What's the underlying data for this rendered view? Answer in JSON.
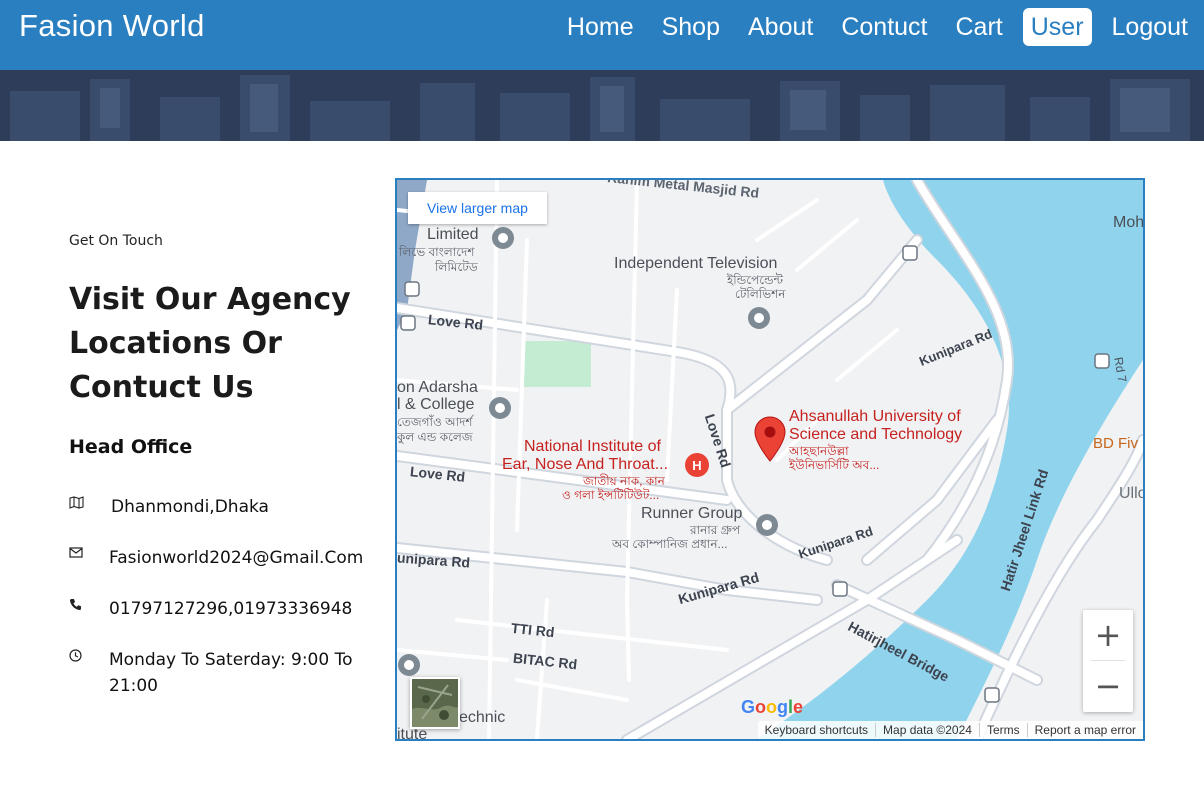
{
  "navbar": {
    "brand": "Fasion World",
    "links": [
      "Home",
      "Shop",
      "About",
      "Contuct",
      "Cart",
      "User",
      "Logout"
    ],
    "active_index": 5,
    "background": "#2a7fc0"
  },
  "contact": {
    "subtitle": "Get On Touch",
    "headline": "Visit Our Agency Locations Or Contuct Us",
    "office_heading": "Head Office",
    "address": "Dhanmondi,Dhaka",
    "email": "Fasionworld2024@Gmail.Com",
    "phone": "01797127296,01973336948",
    "hours": "Monday To Saterday: 9:00 To 21:00",
    "icons": [
      "map-icon",
      "envelope-icon",
      "phone-icon",
      "clock-icon"
    ]
  },
  "map": {
    "view_larger": "View larger map",
    "zoom_in": "+",
    "zoom_out": "−",
    "google": "Google",
    "attribution": [
      "Keyboard shortcuts",
      "Map data ©2024",
      "Terms",
      "Report a map error"
    ],
    "labels": {
      "masjid": "Rahim Metal Masjid Rd",
      "limited": "Limited",
      "limited_bn1": "লিভে বাংলাদেশ",
      "limited_bn2": "লিমিটেড",
      "independent": "Independent Television",
      "independent_bn1": "ইন্ডিপেন্ডেন্ট",
      "independent_bn2": "টেলিভিশন",
      "mohakhali": "Moh",
      "love_rd_1": "Love Rd",
      "love_rd_2": "Love Rd",
      "love_rd_3": "Love Rd",
      "kunipara_1": "Kunipara Rd",
      "kunipara_2": "Kunipara Rd",
      "kunipara_3": "Kunipara Rd",
      "kunipara_4": "unipara Rd",
      "rd7": "Rd 7",
      "adarsha_1": "on Adarsha",
      "adarsha_2": "l & College",
      "adarsha_bn1": "তেজগাঁও আদর্শ",
      "adarsha_bn2": "কুল এন্ড কলেজ",
      "ahsanullah_1": "Ahsanullah University of",
      "ahsanullah_2": "Science and Technology",
      "ahsanullah_bn1": "আহছানউল্লা",
      "ahsanullah_bn2": "ইউনিভার্সিটি অব...",
      "bd_five": "BD Fiv",
      "ullo": "Ullo",
      "nin_1": "National Institute of",
      "nin_2": "Ear, Nose And Throat...",
      "nin_bn1": "জাতীয় নাক, কান",
      "nin_bn2": "ও গলা ইন্সটিটিউট...",
      "runner": "Runner Group",
      "runner_bn1": "রানার গ্রুপ",
      "runner_bn2": "অব কোম্পানিজ প্রধান...",
      "hatir_link": "Hatir Jheel Link Rd",
      "hatirjheel_bridge": "Hatirjheel Bridge",
      "tti": "TTI Rd",
      "bitac": "BITAC Rd",
      "technic": "echnic",
      "titute": "itute"
    }
  },
  "colors": {
    "water": "#8fd3ec",
    "road": "#ffffff",
    "road_edge": "#cfd6de",
    "land": "#f1f2f4",
    "park": "#c4ecd2",
    "pin_red": "#ea4335"
  }
}
